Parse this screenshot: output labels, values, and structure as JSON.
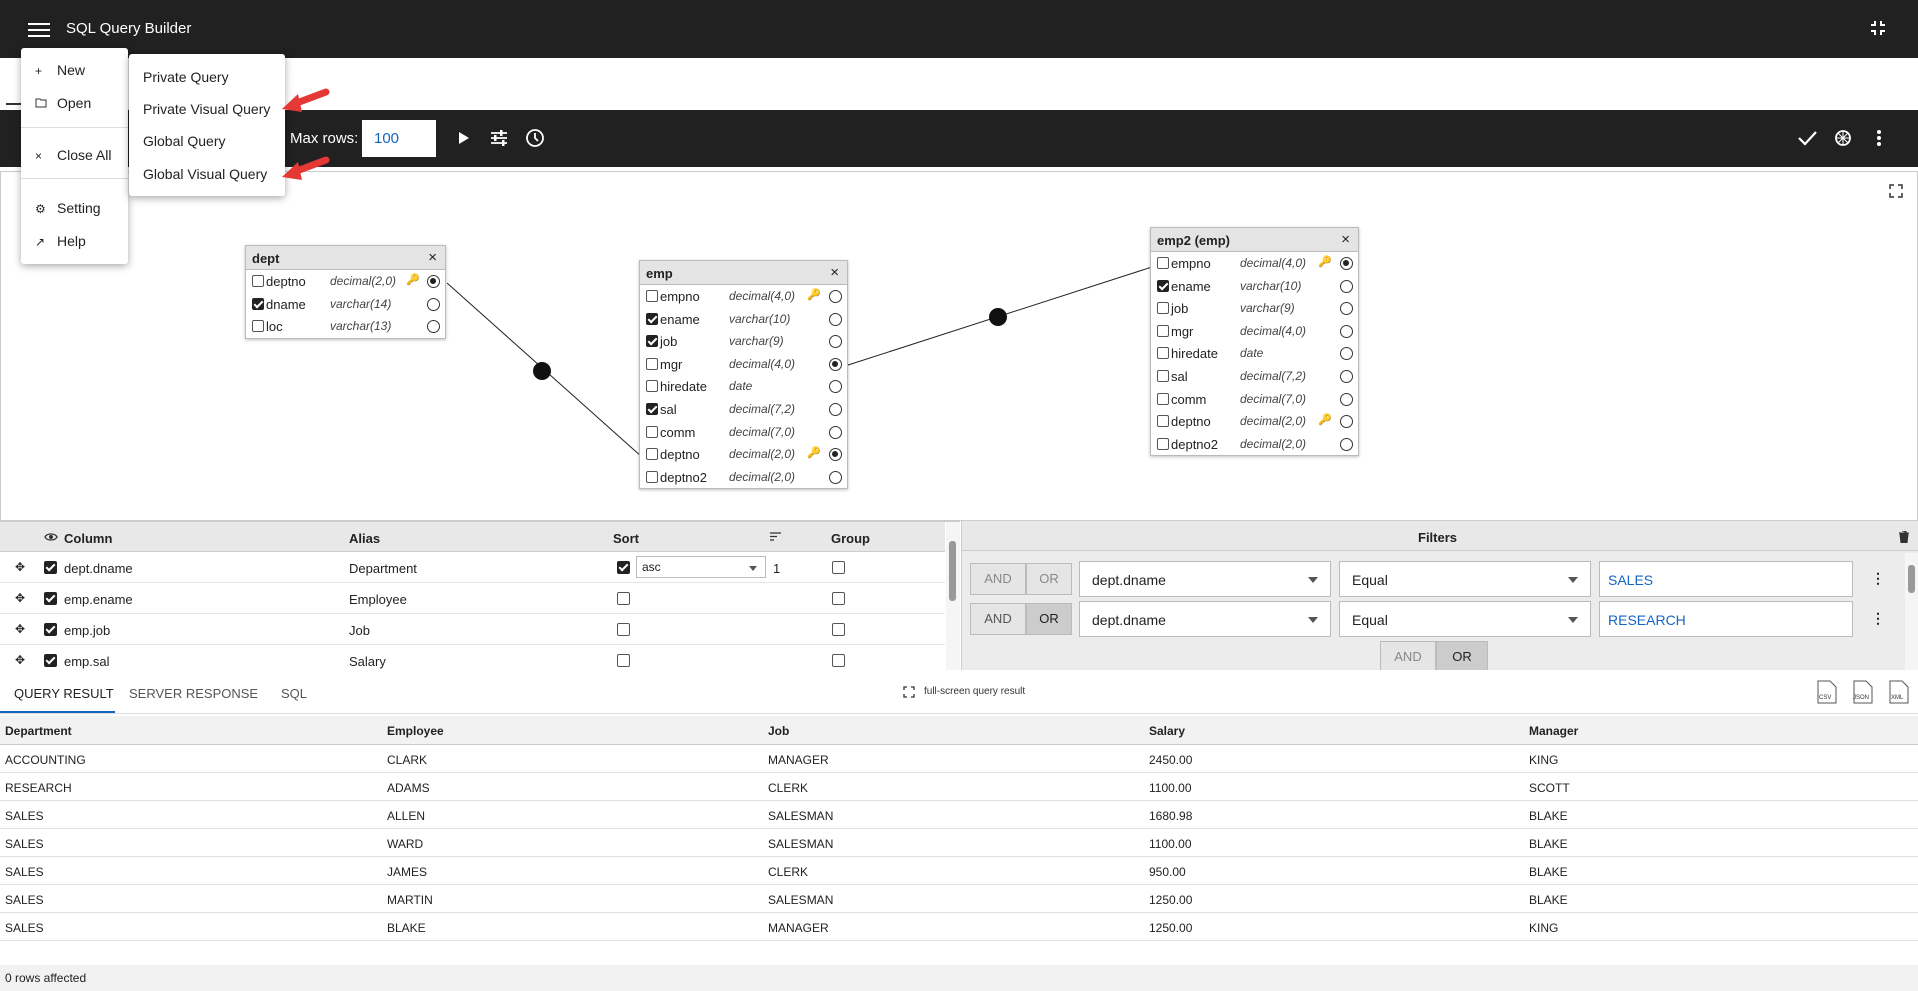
{
  "app": {
    "title": "SQL Query Builder"
  },
  "toolbar": {
    "max_rows_label": "Max rows:",
    "max_rows_value": "100"
  },
  "menu": {
    "items": [
      {
        "icon": "+",
        "label": "New"
      },
      {
        "icon": "folder-icon",
        "label": "Open"
      },
      {
        "icon": "×",
        "label": "Close All"
      },
      {
        "icon": "gear-icon",
        "label": "Setting"
      },
      {
        "icon": "external-link-icon",
        "label": "Help"
      }
    ],
    "submenu": [
      "Private Query",
      "Private Visual Query",
      "Global Query",
      "Global Visual Query"
    ]
  },
  "tables": {
    "dept": {
      "title": "dept",
      "columns": [
        {
          "name": "deptno",
          "type": "decimal(2,0)",
          "checked": false,
          "key": true,
          "radio": true
        },
        {
          "name": "dname",
          "type": "varchar(14)",
          "checked": true,
          "key": false,
          "radio": false
        },
        {
          "name": "loc",
          "type": "varchar(13)",
          "checked": false,
          "key": false,
          "radio": false
        }
      ]
    },
    "emp": {
      "title": "emp",
      "columns": [
        {
          "name": "empno",
          "type": "decimal(4,0)",
          "checked": false,
          "key": true,
          "radio": false
        },
        {
          "name": "ename",
          "type": "varchar(10)",
          "checked": true,
          "key": false,
          "radio": false
        },
        {
          "name": "job",
          "type": "varchar(9)",
          "checked": true,
          "key": false,
          "radio": false
        },
        {
          "name": "mgr",
          "type": "decimal(4,0)",
          "checked": false,
          "key": false,
          "radio": true
        },
        {
          "name": "hiredate",
          "type": "date",
          "checked": false,
          "key": false,
          "radio": false
        },
        {
          "name": "sal",
          "type": "decimal(7,2)",
          "checked": true,
          "key": false,
          "radio": false
        },
        {
          "name": "comm",
          "type": "decimal(7,0)",
          "checked": false,
          "key": false,
          "radio": false
        },
        {
          "name": "deptno",
          "type": "decimal(2,0)",
          "checked": false,
          "key": true,
          "radio": true
        },
        {
          "name": "deptno2",
          "type": "decimal(2,0)",
          "checked": false,
          "key": false,
          "radio": false
        }
      ]
    },
    "emp2": {
      "title": "emp2 (emp)",
      "columns": [
        {
          "name": "empno",
          "type": "decimal(4,0)",
          "checked": false,
          "key": true,
          "radio": true
        },
        {
          "name": "ename",
          "type": "varchar(10)",
          "checked": true,
          "key": false,
          "radio": false
        },
        {
          "name": "job",
          "type": "varchar(9)",
          "checked": false,
          "key": false,
          "radio": false
        },
        {
          "name": "mgr",
          "type": "decimal(4,0)",
          "checked": false,
          "key": false,
          "radio": false
        },
        {
          "name": "hiredate",
          "type": "date",
          "checked": false,
          "key": false,
          "radio": false
        },
        {
          "name": "sal",
          "type": "decimal(7,2)",
          "checked": false,
          "key": false,
          "radio": false
        },
        {
          "name": "comm",
          "type": "decimal(7,0)",
          "checked": false,
          "key": false,
          "radio": false
        },
        {
          "name": "deptno",
          "type": "decimal(2,0)",
          "checked": false,
          "key": true,
          "radio": false
        },
        {
          "name": "deptno2",
          "type": "decimal(2,0)",
          "checked": false,
          "key": false,
          "radio": false
        }
      ]
    }
  },
  "columns_grid": {
    "headers": {
      "column": "Column",
      "alias": "Alias",
      "sort": "Sort",
      "group": "Group"
    },
    "rows": [
      {
        "column": "dept.dname",
        "alias": "Department",
        "sort_checked": true,
        "sort_dir": "asc",
        "sort_order": "1"
      },
      {
        "column": "emp.ename",
        "alias": "Employee",
        "sort_checked": false,
        "sort_dir": "",
        "sort_order": ""
      },
      {
        "column": "emp.job",
        "alias": "Job",
        "sort_checked": false,
        "sort_dir": "",
        "sort_order": ""
      },
      {
        "column": "emp.sal",
        "alias": "Salary",
        "sort_checked": false,
        "sort_dir": "",
        "sort_order": ""
      }
    ]
  },
  "filters": {
    "title": "Filters",
    "and_label": "AND",
    "or_label": "OR",
    "rows": [
      {
        "field": "dept.dname",
        "op": "Equal",
        "value": "SALES"
      },
      {
        "field": "dept.dname",
        "op": "Equal",
        "value": "RESEARCH"
      }
    ]
  },
  "results": {
    "tabs": [
      "QUERY RESULT",
      "SERVER RESPONSE",
      "SQL"
    ],
    "fullscreen_label": "full-screen query result",
    "export": [
      "CSV",
      "JSON",
      "XML"
    ],
    "headers": [
      "Department",
      "Employee",
      "Job",
      "Salary",
      "Manager"
    ],
    "rows": [
      [
        "ACCOUNTING",
        "CLARK",
        "MANAGER",
        "2450.00",
        "KING"
      ],
      [
        "RESEARCH",
        "ADAMS",
        "CLERK",
        "1100.00",
        "SCOTT"
      ],
      [
        "SALES",
        "ALLEN",
        "SALESMAN",
        "1680.98",
        "BLAKE"
      ],
      [
        "SALES",
        "WARD",
        "SALESMAN",
        "1100.00",
        "BLAKE"
      ],
      [
        "SALES",
        "JAMES",
        "CLERK",
        "950.00",
        "BLAKE"
      ],
      [
        "SALES",
        "MARTIN",
        "SALESMAN",
        "1250.00",
        "BLAKE"
      ],
      [
        "SALES",
        "BLAKE",
        "MANAGER",
        "1250.00",
        "KING"
      ]
    ],
    "status": "0 rows affected"
  },
  "colors": {
    "accent": "#1565c0",
    "annotation_arrow": "#e53935",
    "topbar": "#212121"
  }
}
